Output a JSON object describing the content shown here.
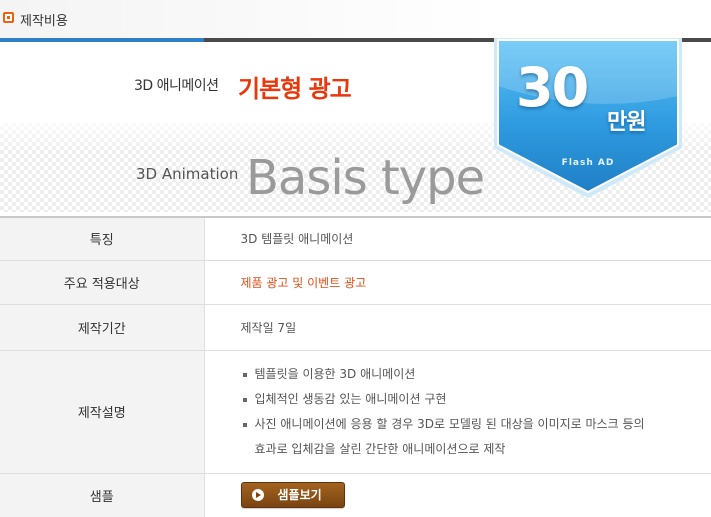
{
  "section": {
    "title": "제작비용"
  },
  "banner": {
    "sub_ko": "3D 애니메이션",
    "main_ko": "기본형 광고",
    "sub_en": "3D Animation",
    "main_en": "Basis type"
  },
  "badge": {
    "price": "30",
    "unit": "만원",
    "label": "Flash AD",
    "color": "#2f9be0"
  },
  "table": {
    "feature": {
      "label": "특징",
      "value": "3D 템플릿 애니메이션"
    },
    "target": {
      "label": "주요 적용대상",
      "value": "제품 광고 및 이벤트 광고",
      "color": "#e2501b"
    },
    "period": {
      "label": "제작기간",
      "value": "제작일 7일"
    },
    "description": {
      "label": "제작설명",
      "items": [
        "템플릿을 이용한 3D 애니메이션",
        "입체적인 생동감 있는 애니메이션 구현",
        "사진 애니메이션에 응용 할 경우 3D로 모델링 된 대상을 이미지로 마스크 등의"
      ],
      "continuation": "효과로 입체감을 살린 간단한 애니메이션으로 제작"
    },
    "sample": {
      "label": "샘플",
      "button": "샘플보기"
    }
  },
  "icons": {
    "bullet": "square-bullet-icon",
    "play": "play-icon"
  }
}
